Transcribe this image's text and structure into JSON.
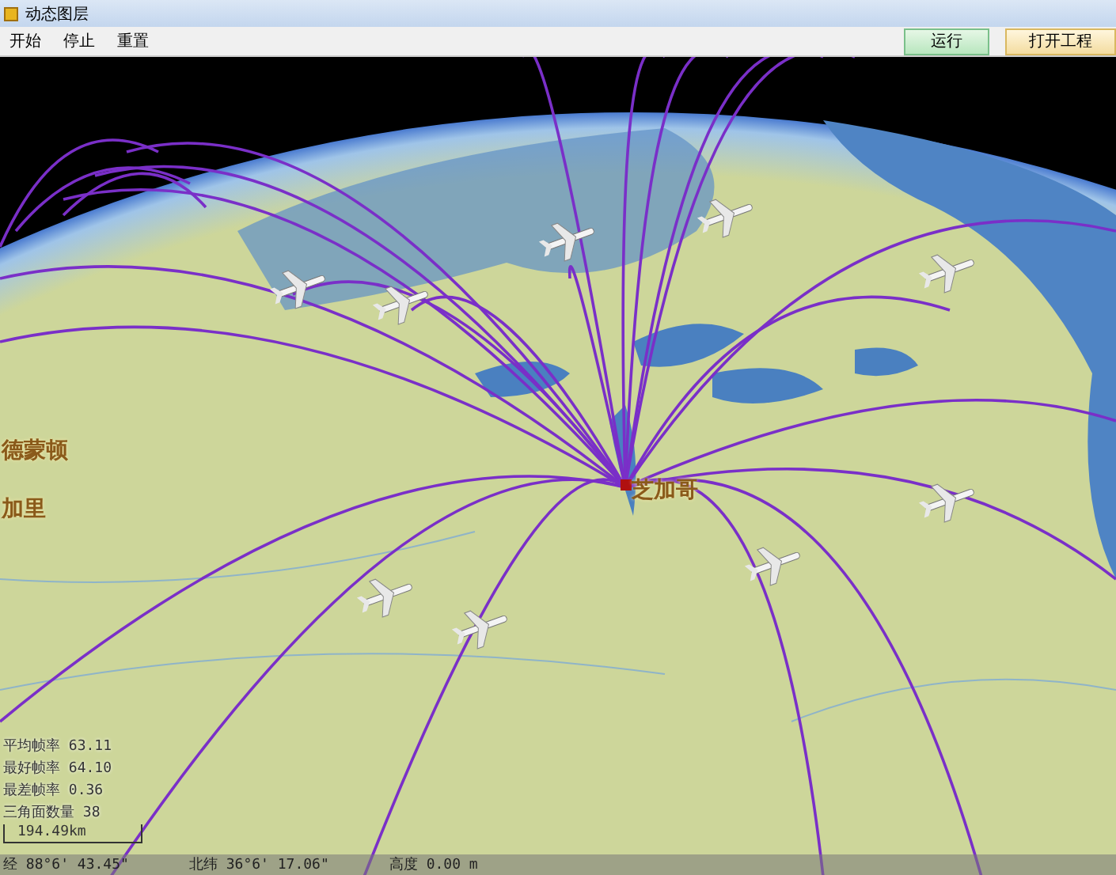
{
  "window": {
    "title": "动态图层"
  },
  "menu": [
    {
      "label": "开始"
    },
    {
      "label": "停止"
    },
    {
      "label": "重置"
    }
  ],
  "buttons": [
    {
      "label": "运行",
      "kind": "run"
    },
    {
      "label": "打开工程",
      "kind": "open"
    }
  ],
  "map_labels": [
    {
      "text": "德蒙顿",
      "kind": "city"
    },
    {
      "text": "加里",
      "kind": "city"
    },
    {
      "text": "芝加哥",
      "kind": "hub"
    }
  ],
  "stats": [
    "平均帧率 63.11",
    "最好帧率 64.10",
    "最差帧率 0.36",
    "三角面数量 38"
  ],
  "scale_bar": "194.49km",
  "status_bar": {
    "longitude": "经 88°6' 43.45\"",
    "latitude": "北纬 36°6' 17.06\"",
    "altitude": "高度 0.00 m"
  }
}
